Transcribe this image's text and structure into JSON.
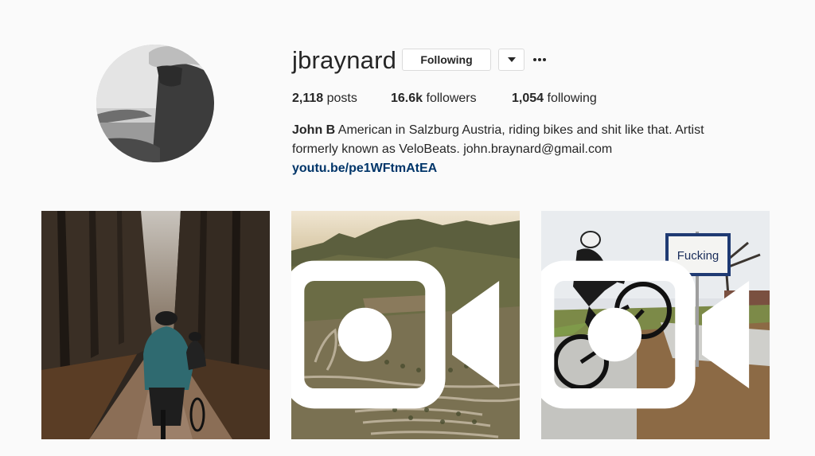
{
  "profile": {
    "username": "jbraynard",
    "following_button": "Following",
    "dropdown_icon": "caret-down-icon",
    "more_icon": "more-horizontal-icon",
    "avatar_alt": "profile photo"
  },
  "stats": {
    "posts_count": "2,118",
    "posts_label": "posts",
    "followers_count": "16.6k",
    "followers_label": "followers",
    "following_count": "1,054",
    "following_label": "following"
  },
  "bio": {
    "full_name": "John B",
    "text": "American in Salzburg Austria, riding bikes and shit like that. Artist formerly known as VeloBeats. john.braynard@gmail.com",
    "link": "youtu.be/pe1WFtmAtEA"
  },
  "posts": [
    {
      "description": "cyclists riding on forest gravel road",
      "is_video": false
    },
    {
      "description": "aerial view of winding mountain road",
      "is_video": true,
      "video_icon": "video-camera-icon"
    },
    {
      "description": "cyclist doing wheelie past Fucking town sign",
      "is_video": true,
      "video_icon": "video-camera-icon",
      "sign_text": "Fucking"
    }
  ],
  "colors": {
    "background": "#fafafa",
    "text": "#262626",
    "link": "#003569",
    "border": "#dbdbdb"
  }
}
